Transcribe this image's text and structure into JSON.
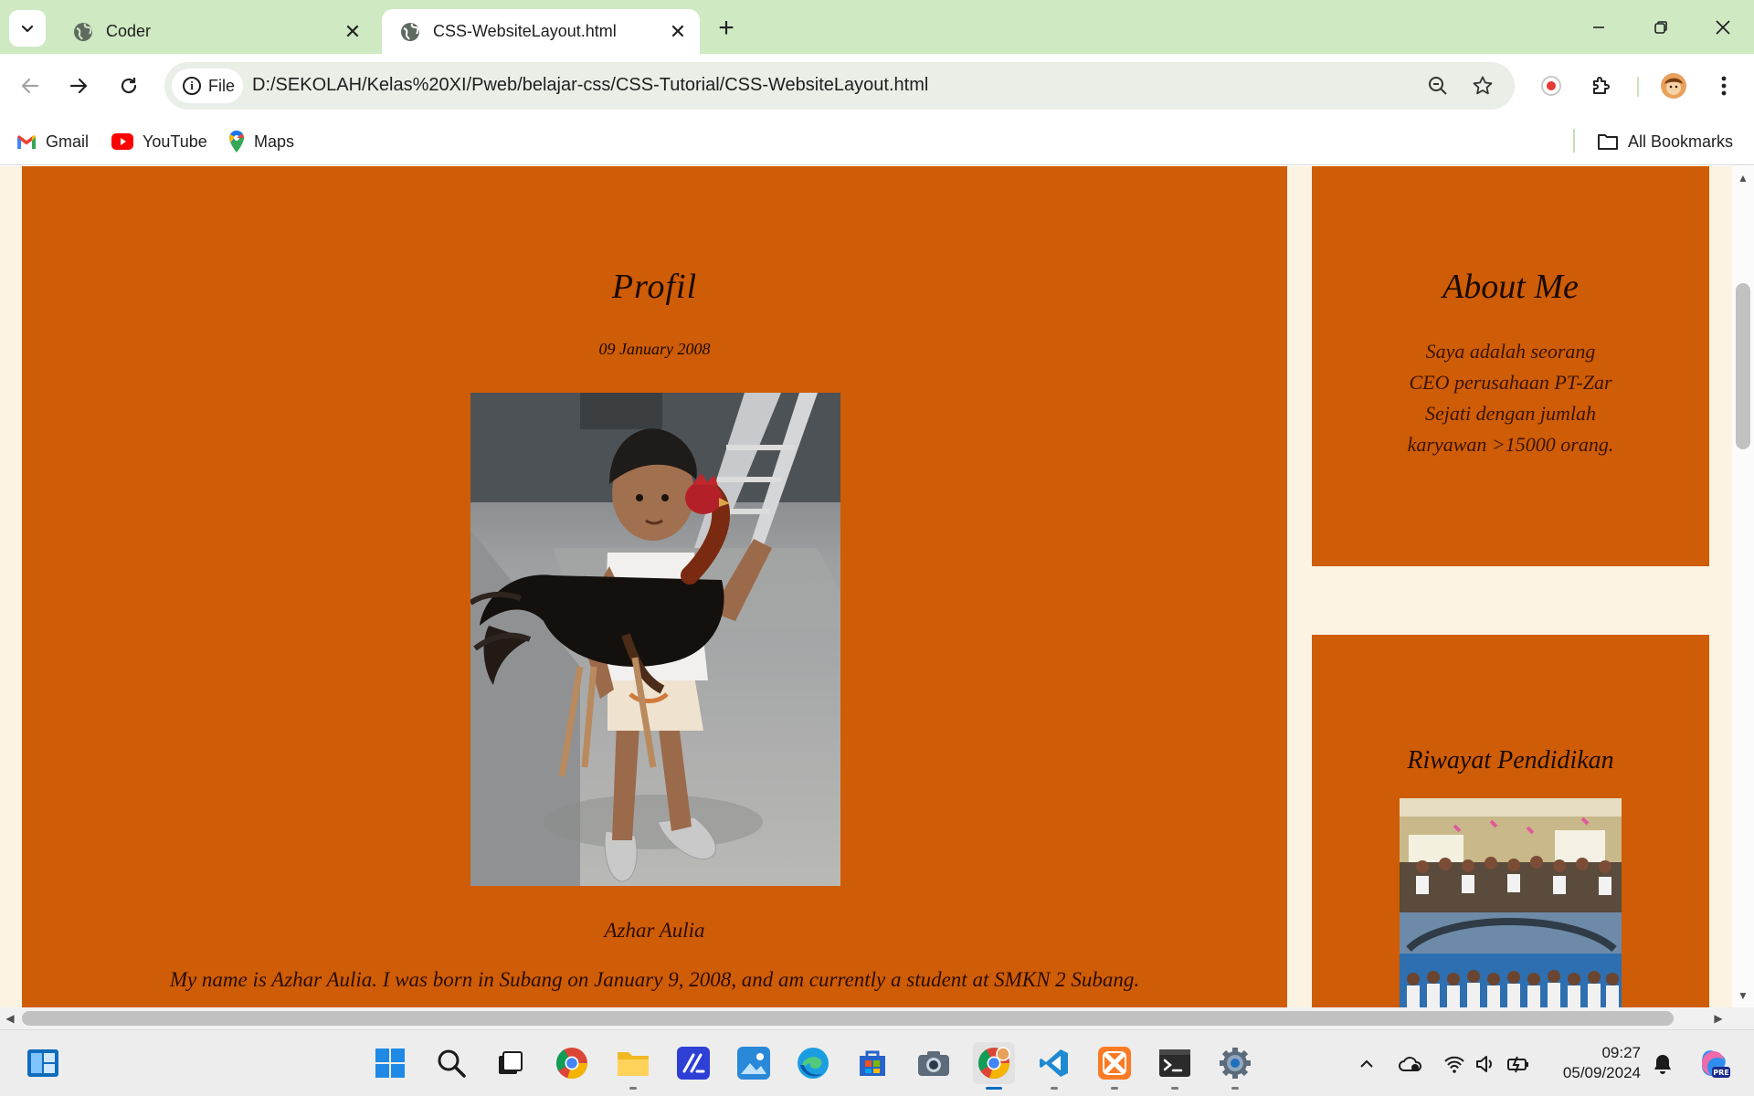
{
  "browser": {
    "tabs": [
      {
        "title": "Coder",
        "active": false
      },
      {
        "title": "CSS-WebsiteLayout.html",
        "active": true
      }
    ],
    "new_tab_label": "+",
    "site_chip_label": "File",
    "url": "D:/SEKOLAH/Kelas%20XI/Pweb/belajar-css/CSS-Tutorial/CSS-WebsiteLayout.html",
    "bookmarks": [
      {
        "label": "Gmail",
        "icon": "gmail-icon"
      },
      {
        "label": "YouTube",
        "icon": "youtube-icon"
      },
      {
        "label": "Maps",
        "icon": "maps-icon"
      }
    ],
    "all_bookmarks_label": "All Bookmarks"
  },
  "page": {
    "main": {
      "title": "Profil",
      "date": "09 January 2008",
      "photo_alt": "boy-holding-rooster-photo",
      "name": "Azhar Aulia",
      "bio": "My name is Azhar Aulia. I was born in Subang on January 9, 2008, and am currently a student at SMKN 2 Subang."
    },
    "about": {
      "title": "About Me",
      "text": "Saya adalah seorang CEO perusahaan PT-Zar Sejati dengan jumlah karyawan >15000 orang."
    },
    "education": {
      "title": "Riwayat Pendidikan",
      "photo_alt": "classroom-group-photo"
    }
  },
  "taskbar": {
    "time": "09:27",
    "date": "05/09/2024"
  },
  "colors": {
    "tabstrip": "#cfe9c3",
    "card": "#cf5c06",
    "page_bg": "#fdf3e3"
  }
}
